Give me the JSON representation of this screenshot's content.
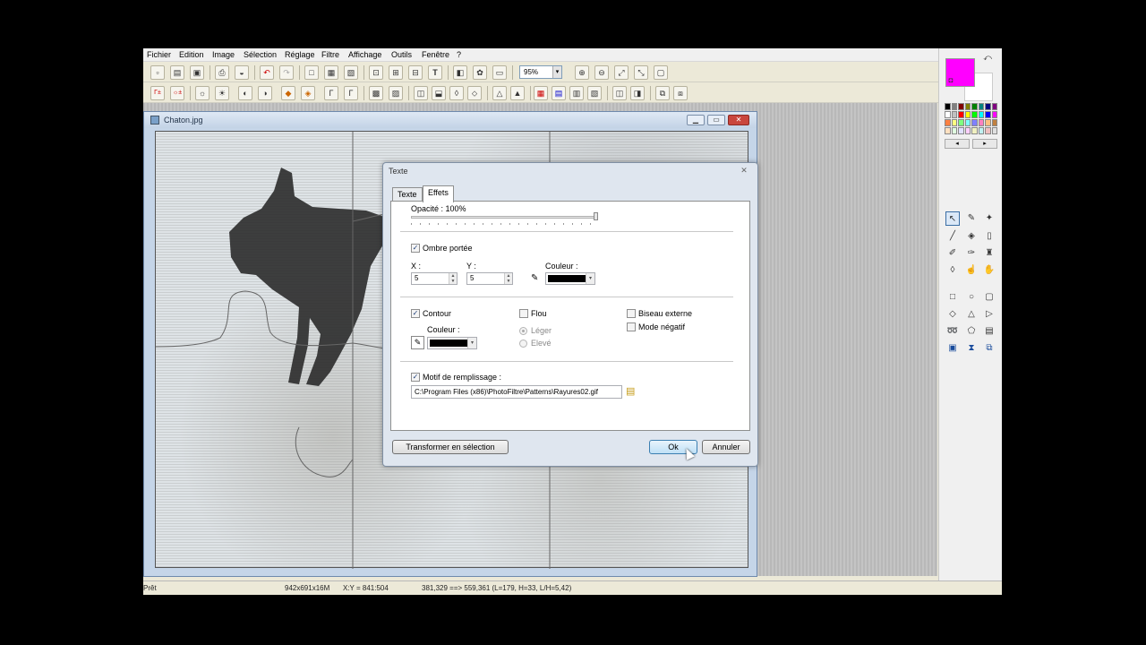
{
  "menu": [
    "Fichier",
    "Edition",
    "Image",
    "Sélection",
    "Réglage",
    "Filtre",
    "Affichage",
    "Outils",
    "Fenêtre",
    "?"
  ],
  "toolbar": {
    "zoom": "95%"
  },
  "image_window": {
    "title": "Chaton.jpg"
  },
  "dialog": {
    "title": "Texte",
    "tabs": [
      "Texte",
      "Effets"
    ],
    "opacity_label": "Opacité : 100%",
    "opacity_value": 100,
    "shadow_label": "Ombre portée",
    "x_label": "X :",
    "x_value": "5",
    "y_label": "Y :",
    "y_value": "5",
    "shadow_color_label": "Couleur :",
    "contour_label": "Contour",
    "contour_color_label": "Couleur :",
    "blur_label": "Flou",
    "light_label": "Léger",
    "high_label": "Elevé",
    "bevel_label": "Biseau externe",
    "negative_label": "Mode négatif",
    "pattern_label": "Motif de remplissage :",
    "pattern_path": "C:\\Program Files (x86)\\PhotoFiltre\\Patterns\\Rayures02.gif",
    "convert_button": "Transformer en sélection",
    "ok_button": "Ok",
    "cancel_button": "Annuler"
  },
  "colors": {
    "foreground": "#ff00ff",
    "background": "#ffffff"
  },
  "status": {
    "state": "Prêt",
    "image_info": "942x691x16M",
    "coords": "X:Y = 841:504",
    "selection": "381,329 ==> 559,361 (L=179, H=33, L/H=5,42)"
  }
}
